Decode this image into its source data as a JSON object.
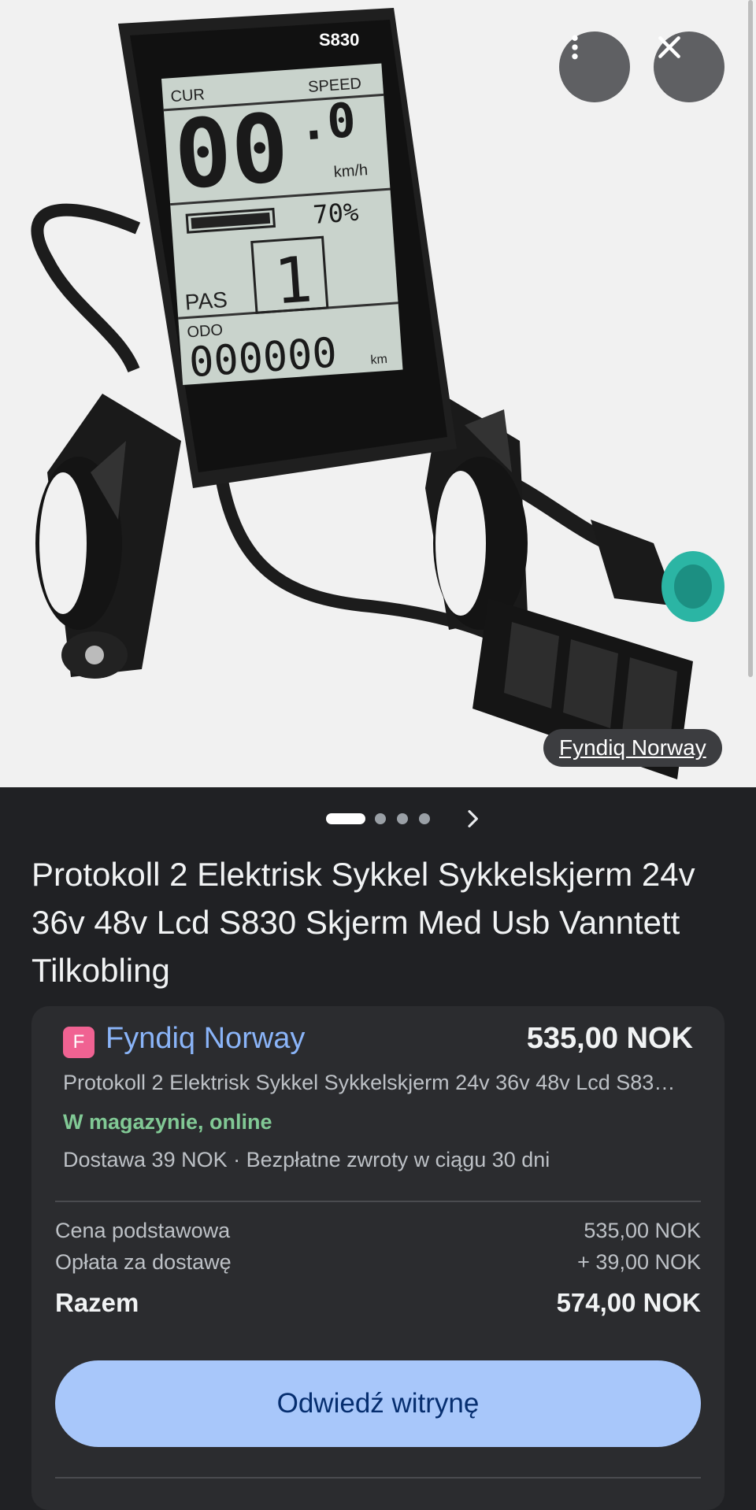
{
  "hero": {
    "more_icon": "more-vert-icon",
    "close_icon": "close-icon",
    "source_label": "Fyndiq Norway",
    "display": {
      "model": "S830",
      "cur_label": "CUR",
      "speed_label": "SPEED",
      "speed_value": "00",
      "speed_decimal": ".0",
      "speed_unit": "km/h",
      "battery_percent": "70%",
      "pas_label": "PAS",
      "pas_value": "1",
      "odo_label": "ODO",
      "odo_value": "000000",
      "odo_unit": "km"
    }
  },
  "pager": {
    "count": 4,
    "active_index": 0,
    "next_icon": "chevron-right-icon"
  },
  "product": {
    "title": "Protokoll 2 Elektrisk Sykkel Sykkelskjerm 24v 36v 48v Lcd S830 Skjerm Med Usb Vanntett Tilkobling"
  },
  "offer": {
    "merchant_initial": "F",
    "merchant_name": "Fyndiq Norway",
    "price": "535,00 NOK",
    "description": "Protokoll 2 Elektrisk Sykkel Sykkelskjerm 24v 36v 48v Lcd S830 Skjerm Med Usb Vanntett Tilkobling",
    "stock": "W magazynie, online",
    "delivery": "Dostawa 39 NOK · Bezpłatne zwroty w ciągu 30 dni",
    "breakdown": {
      "base_label": "Cena podstawowa",
      "base_value": "535,00 NOK",
      "shipping_label": "Opłata za dostawę",
      "shipping_value": "+ 39,00 NOK",
      "total_label": "Razem",
      "total_value": "574,00 NOK"
    },
    "visit_button": "Odwiedź witrynę"
  },
  "colors": {
    "page_bg": "#202124",
    "card_bg": "#2b2c2f",
    "link": "#8ab4f8",
    "in_stock": "#81c995",
    "button_bg": "#a8c7fa",
    "button_text": "#062e6f"
  }
}
